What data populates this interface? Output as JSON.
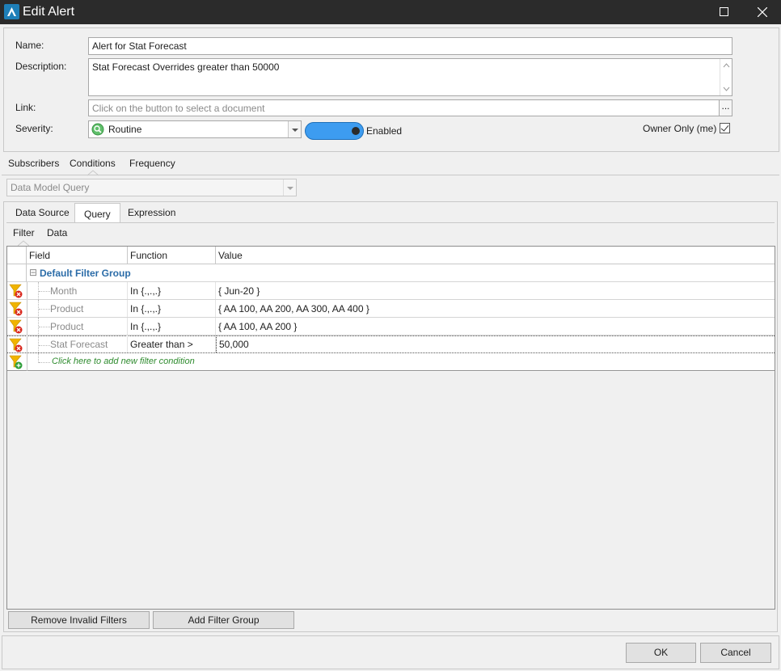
{
  "window": {
    "title": "Edit Alert"
  },
  "form": {
    "name_label": "Name:",
    "name_value": "Alert for Stat Forecast",
    "description_label": "Description:",
    "description_value": "Stat Forecast Overrides greater than 50000",
    "link_label": "Link:",
    "link_placeholder": "Click on the button to select a document",
    "link_button": "...",
    "severity_label": "Severity:",
    "severity_value": "Routine",
    "enabled_label": "Enabled",
    "enabled": true,
    "owner_only_label": "Owner Only (me)",
    "owner_only_checked": true
  },
  "main_tabs": [
    {
      "label": "Subscribers",
      "active": false
    },
    {
      "label": "Conditions",
      "active": true
    },
    {
      "label": "Frequency",
      "active": false
    }
  ],
  "query_type": {
    "value": "Data Model Query",
    "disabled": true
  },
  "sub_tabs": [
    {
      "label": "Data Source",
      "active": false
    },
    {
      "label": "Query",
      "active": true
    },
    {
      "label": "Expression",
      "active": false
    }
  ],
  "inner_tabs": [
    {
      "label": "Filter",
      "active": true
    },
    {
      "label": "Data",
      "active": false
    }
  ],
  "grid": {
    "columns": [
      "Field",
      "Function",
      "Value"
    ],
    "group_label": "Default Filter Group",
    "group_toggle": "⊟",
    "rows": [
      {
        "field": "Month",
        "function": "In {.,.,.}",
        "value": "{ Jun-20 }"
      },
      {
        "field": "Product",
        "function": "In {.,.,.}",
        "value": "{ AA 100, AA 200, AA 300, AA 400 }"
      },
      {
        "field": "Product",
        "function": "In {.,.,.}",
        "value": "{ AA 100, AA 200 }"
      },
      {
        "field": "Stat Forecast",
        "function": "Greater than >",
        "value": "50,000"
      }
    ],
    "add_row_text": "Click here to add new filter condition"
  },
  "grid_buttons": {
    "remove_invalid": "Remove Invalid Filters",
    "add_group": "Add Filter Group"
  },
  "footer": {
    "ok": "OK",
    "cancel": "Cancel"
  },
  "colors": {
    "titlebar": "#2b2b2b",
    "toggle": "#3d9cf0",
    "group_text": "#2b6ca8",
    "add_row_text": "#2e8b2e",
    "filter_icon": "#f0b400",
    "remove_icon": "#d9261c"
  }
}
